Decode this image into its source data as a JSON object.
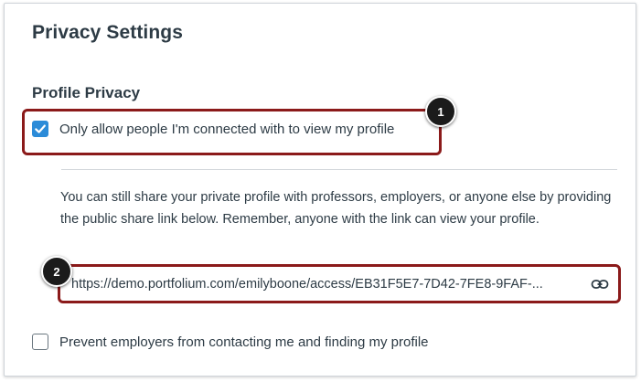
{
  "page": {
    "title": "Privacy Settings"
  },
  "profile_privacy": {
    "heading": "Profile Privacy",
    "connected_only": {
      "label": "Only allow people I'm connected with to view my profile",
      "checked": true
    },
    "info_text": "You can still share your private profile with professors, employers, or anyone else by providing the public share link below. Remember, anyone with the link can view your profile.",
    "share_link": {
      "value": "https://demo.portfolium.com/emilyboone/access/EB31F5E7-7D42-7FE8-9FAF-...",
      "copy_icon": "link-icon"
    },
    "prevent_employers": {
      "label": "Prevent employers from contacting me and finding my profile",
      "checked": false
    }
  },
  "callouts": [
    "1",
    "2"
  ],
  "colors": {
    "accent": "#2b8bd8",
    "highlight_border": "#8b1a1a",
    "callout_bg": "#1b1b1b",
    "text": "#2d3b45"
  }
}
